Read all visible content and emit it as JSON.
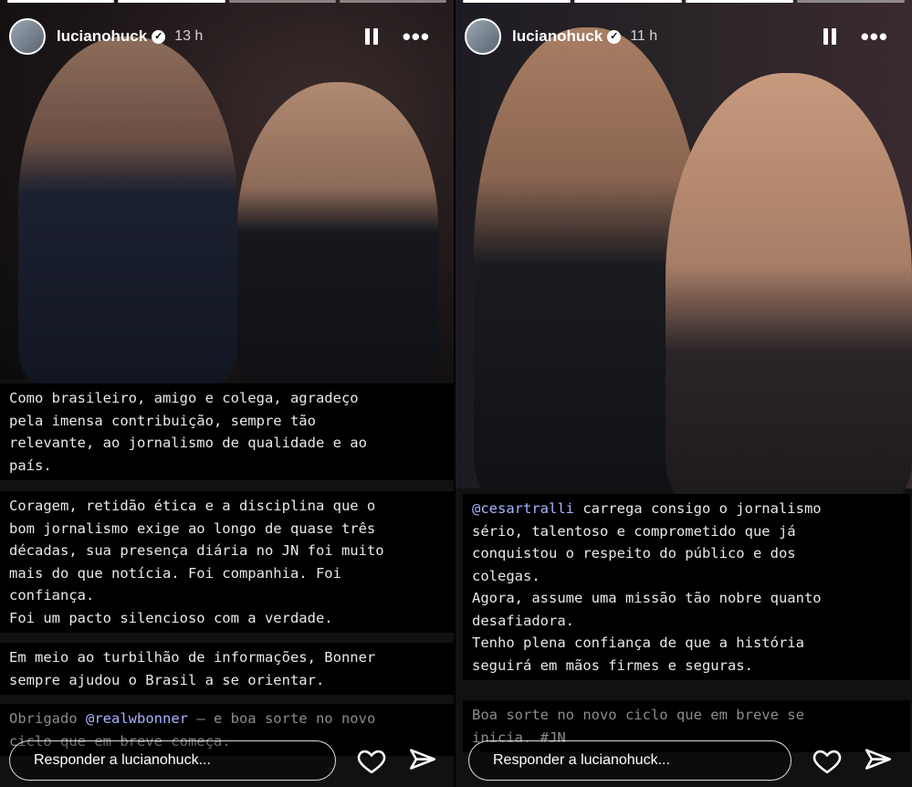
{
  "stories": [
    {
      "username": "lucianohuck",
      "time": "13 h",
      "paragraphs": [
        "Como brasileiro, amigo e colega, agradeço\npela imensa contribuição, sempre tão\nrelevante, ao jornalismo de qualidade e ao\npaís.",
        "Coragem, retidão ética e a disciplina que o\nbom jornalismo exige ao longo de quase três\ndécadas, sua presença diária no JN foi muito\nmais do que notícia. Foi companhia. Foi\nconfiança.\nFoi um pacto silencioso com a verdade.",
        "Em meio ao turbilhão de informações, Bonner\nsempre ajudou o Brasil a se orientar."
      ],
      "closing_prefix": "Obrigado ",
      "closing_mention": "@realwbonner",
      "closing_suffix": " — e boa sorte no novo\nciclo que em breve começa.",
      "reply_placeholder": "Responder a lucianohuck..."
    },
    {
      "username": "lucianohuck",
      "time": "11 h",
      "mention": "@cesartralli",
      "paragraph_rest": " carrega consigo o jornalismo\nsério, talentoso e comprometido que já\nconquistou o respeito do público e dos\ncolegas.\nAgora, assume uma missão tão nobre quanto\ndesafiadora.\nTenho plena confiança de que a história\nseguirá em mãos firmes e seguras.",
      "closing": "Boa sorte no novo ciclo que em breve se\ninicia. #JN",
      "reply_placeholder": "Responder a lucianohuck..."
    }
  ],
  "icons": {
    "verified": "verified-badge-icon",
    "pause": "pause-icon",
    "more": "more-icon",
    "heart": "heart-icon",
    "send": "send-icon"
  },
  "colors": {
    "mention": "#a7b4ff",
    "text": "#e9e9e9",
    "background": "#000000"
  }
}
